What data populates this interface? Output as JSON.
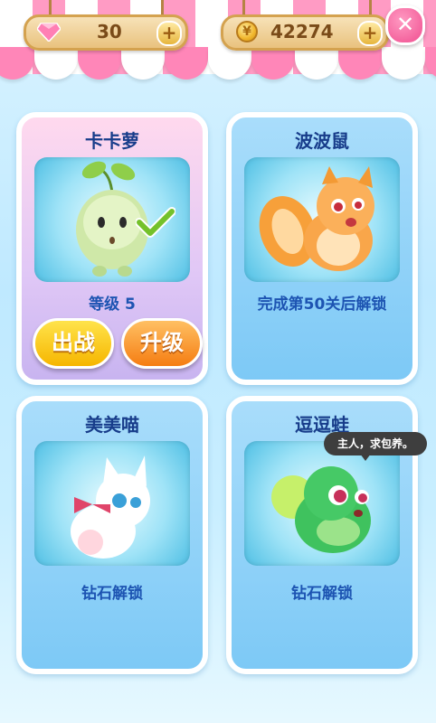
{
  "top_bar": {
    "gems": {
      "icon": "diamond-icon",
      "value": "30",
      "add_label": "+"
    },
    "coins": {
      "icon": "coin-icon",
      "value": "42274",
      "add_label": "+"
    },
    "close_label": "✕"
  },
  "pets": [
    {
      "name": "卡卡萝",
      "level_text": "等级 5",
      "selected": true,
      "battle_label": "出战",
      "upgrade_label": "升级",
      "portrait": "sprout-pet"
    },
    {
      "name": "波波鼠",
      "status_text": "完成第50关后解锁",
      "locked": true,
      "portrait": "orange-hamster-pet"
    },
    {
      "name": "美美喵",
      "status_text": "钻石解锁",
      "locked": true,
      "portrait": "white-kitten-pet"
    },
    {
      "name": "逗逗蛙",
      "status_text": "钻石解锁",
      "locked": true,
      "portrait": "green-frog-pet",
      "speech": "主人，求包养。"
    }
  ],
  "colors": {
    "awning_pink": "#ff86b8",
    "card_blue": "#7dc9f6",
    "card_pink": "#ffd9ee",
    "title_text": "#173c8a",
    "caption_text": "#1d54b2",
    "battle_button": "#f6b600",
    "upgrade_button": "#f57d12"
  }
}
